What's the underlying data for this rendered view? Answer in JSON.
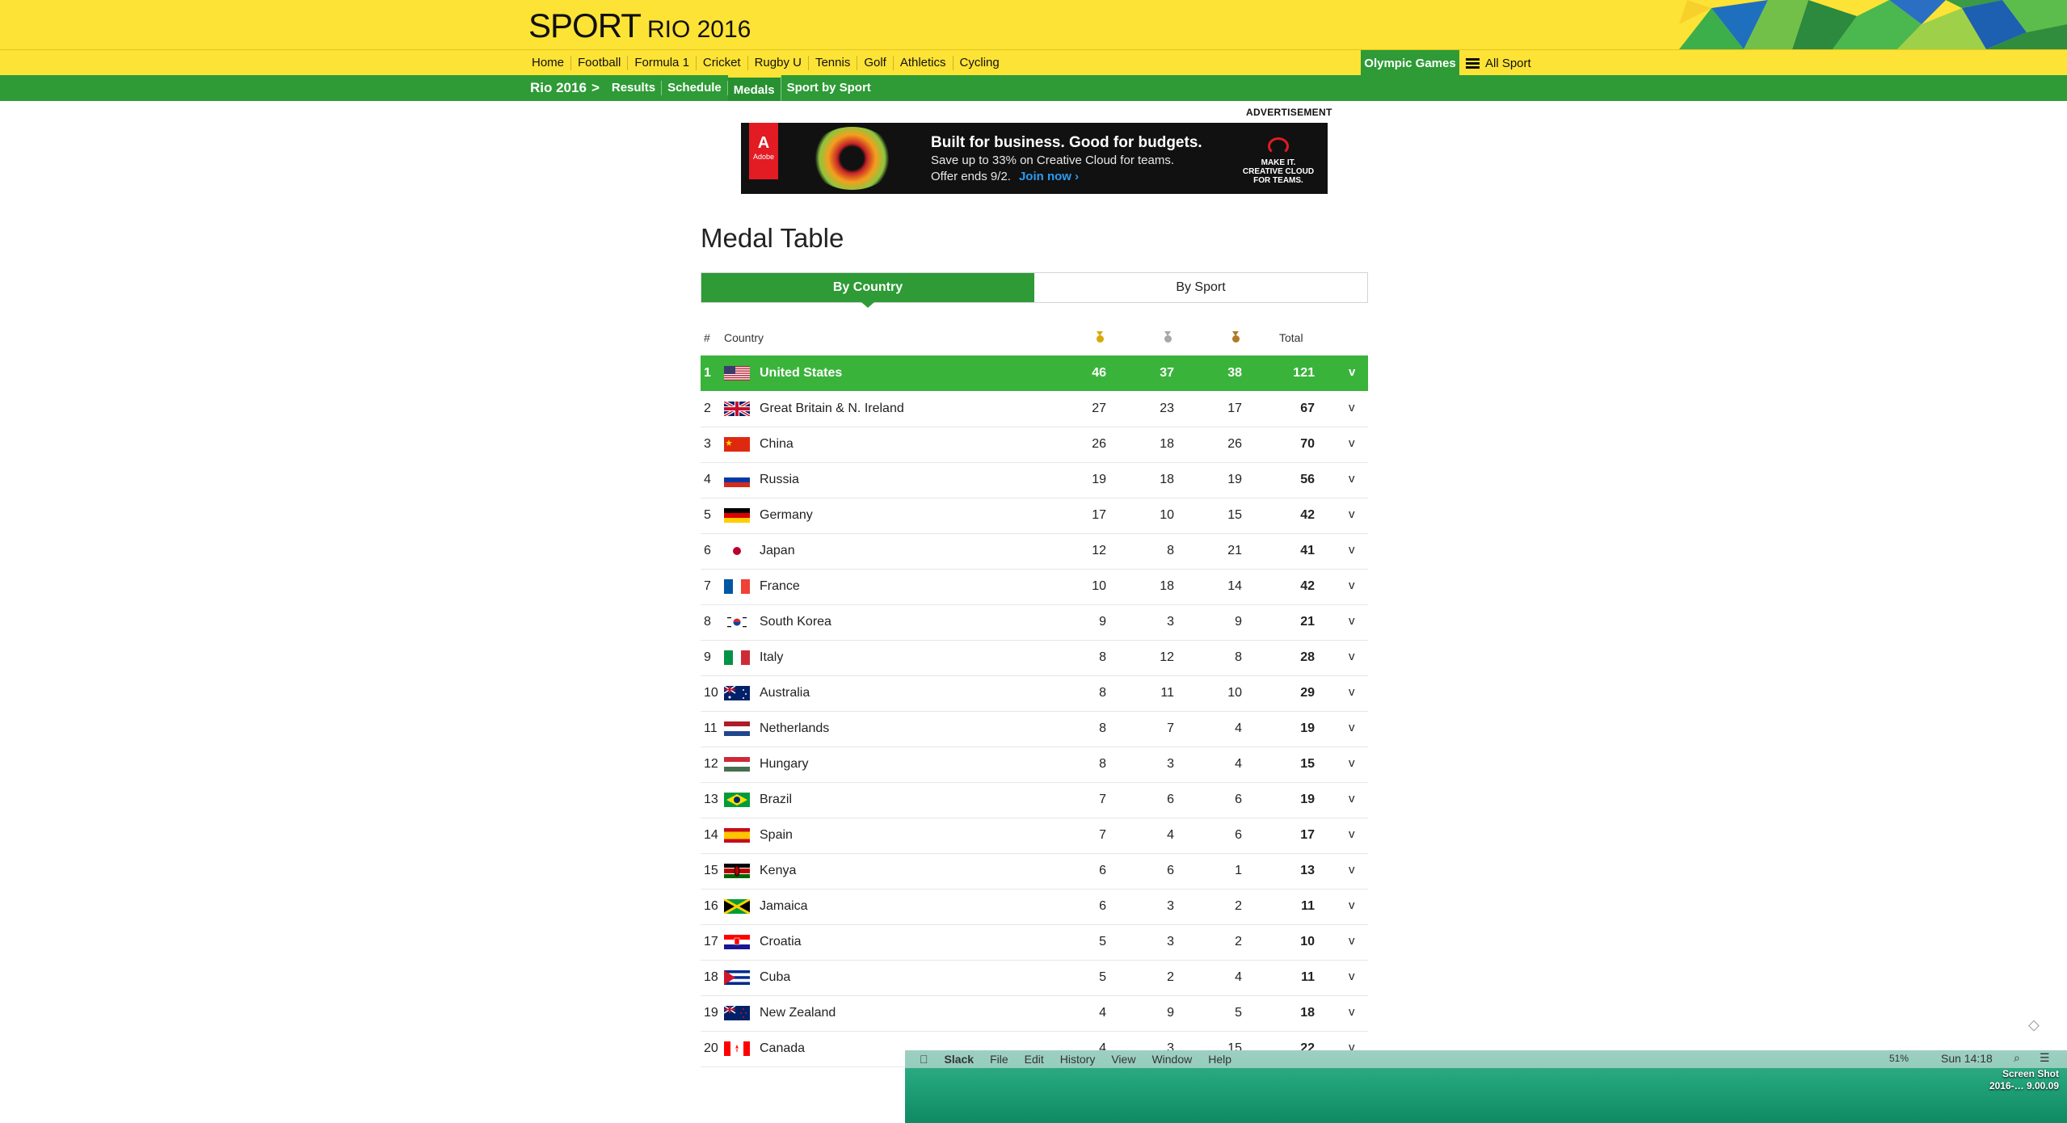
{
  "header": {
    "brand": "SPORT",
    "brand_sub": "RIO 2016",
    "nav": [
      "Home",
      "Football",
      "Formula 1",
      "Cricket",
      "Rugby U",
      "Tennis",
      "Golf",
      "Athletics",
      "Cycling"
    ],
    "olympic_label": "Olympic Games",
    "all_sport_label": "All Sport"
  },
  "subnav": {
    "root": "Rio 2016",
    "separator": ">",
    "items": [
      "Results",
      "Schedule",
      "Medals",
      "Sport by Sport"
    ],
    "active": "Medals"
  },
  "ad": {
    "label": "ADVERTISEMENT",
    "brand_tag": "Adobe",
    "headline": "Built for business. Good for budgets.",
    "line1": "Save up to 33% on Creative Cloud for teams.",
    "line2": "Offer ends 9/2.",
    "cta": "Join now ›",
    "right": "MAKE IT. CREATIVE CLOUD FOR TEAMS."
  },
  "page": {
    "title": "Medal Table",
    "tabs": [
      "By Country",
      "By Sport"
    ],
    "active_tab": "By Country"
  },
  "table": {
    "headers": {
      "rank": "#",
      "country": "Country",
      "total": "Total"
    },
    "medal_colors": {
      "gold": "#d9a90c",
      "silver": "#a8a8a8",
      "bronze": "#b07a2a"
    },
    "rows": [
      {
        "rank": "1",
        "flag": "us",
        "country": "United States",
        "gold": "46",
        "silver": "37",
        "bronze": "38",
        "total": "121"
      },
      {
        "rank": "2",
        "flag": "gb",
        "country": "Great Britain & N. Ireland",
        "gold": "27",
        "silver": "23",
        "bronze": "17",
        "total": "67"
      },
      {
        "rank": "3",
        "flag": "cn",
        "country": "China",
        "gold": "26",
        "silver": "18",
        "bronze": "26",
        "total": "70"
      },
      {
        "rank": "4",
        "flag": "ru",
        "country": "Russia",
        "gold": "19",
        "silver": "18",
        "bronze": "19",
        "total": "56"
      },
      {
        "rank": "5",
        "flag": "de",
        "country": "Germany",
        "gold": "17",
        "silver": "10",
        "bronze": "15",
        "total": "42"
      },
      {
        "rank": "6",
        "flag": "jp",
        "country": "Japan",
        "gold": "12",
        "silver": "8",
        "bronze": "21",
        "total": "41"
      },
      {
        "rank": "7",
        "flag": "fr",
        "country": "France",
        "gold": "10",
        "silver": "18",
        "bronze": "14",
        "total": "42"
      },
      {
        "rank": "8",
        "flag": "kr",
        "country": "South Korea",
        "gold": "9",
        "silver": "3",
        "bronze": "9",
        "total": "21"
      },
      {
        "rank": "9",
        "flag": "it",
        "country": "Italy",
        "gold": "8",
        "silver": "12",
        "bronze": "8",
        "total": "28"
      },
      {
        "rank": "10",
        "flag": "au",
        "country": "Australia",
        "gold": "8",
        "silver": "11",
        "bronze": "10",
        "total": "29"
      },
      {
        "rank": "11",
        "flag": "nl",
        "country": "Netherlands",
        "gold": "8",
        "silver": "7",
        "bronze": "4",
        "total": "19"
      },
      {
        "rank": "12",
        "flag": "hu",
        "country": "Hungary",
        "gold": "8",
        "silver": "3",
        "bronze": "4",
        "total": "15"
      },
      {
        "rank": "13",
        "flag": "br",
        "country": "Brazil",
        "gold": "7",
        "silver": "6",
        "bronze": "6",
        "total": "19"
      },
      {
        "rank": "14",
        "flag": "es",
        "country": "Spain",
        "gold": "7",
        "silver": "4",
        "bronze": "6",
        "total": "17"
      },
      {
        "rank": "15",
        "flag": "ke",
        "country": "Kenya",
        "gold": "6",
        "silver": "6",
        "bronze": "1",
        "total": "13"
      },
      {
        "rank": "16",
        "flag": "jm",
        "country": "Jamaica",
        "gold": "6",
        "silver": "3",
        "bronze": "2",
        "total": "11"
      },
      {
        "rank": "17",
        "flag": "hr",
        "country": "Croatia",
        "gold": "5",
        "silver": "3",
        "bronze": "2",
        "total": "10"
      },
      {
        "rank": "18",
        "flag": "cu",
        "country": "Cuba",
        "gold": "5",
        "silver": "2",
        "bronze": "4",
        "total": "11"
      },
      {
        "rank": "19",
        "flag": "nz",
        "country": "New Zealand",
        "gold": "4",
        "silver": "9",
        "bronze": "5",
        "total": "18"
      },
      {
        "rank": "20",
        "flag": "ca",
        "country": "Canada",
        "gold": "4",
        "silver": "3",
        "bronze": "15",
        "total": "22"
      }
    ]
  },
  "os": {
    "apple": "",
    "app": "Slack",
    "menus": [
      "File",
      "Edit",
      "History",
      "View",
      "Window",
      "Help"
    ],
    "battery": "51%",
    "clock": "Sun 14:18",
    "desktop_file": [
      "Screen Shot",
      "2016-… 9.00.09"
    ]
  }
}
